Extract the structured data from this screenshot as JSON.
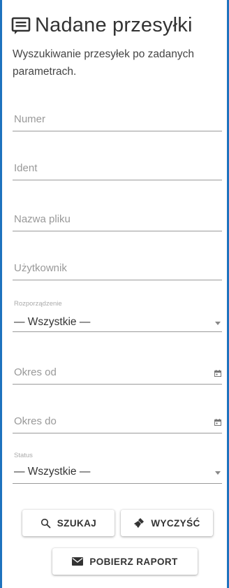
{
  "header": {
    "icon": "message-screen-icon",
    "title": "Nadane przesyłki",
    "subtitle": "Wyszukiwanie przesyłek po zadanych parametrach."
  },
  "form": {
    "numer_placeholder": "Numer",
    "ident_placeholder": "Ident",
    "nazwa_pliku_placeholder": "Nazwa pliku",
    "uzytkownik_placeholder": "Użytkownik",
    "rozporzadzenie_label": "Rozporządzenie",
    "rozporzadzenie_value": "— Wszystkie —",
    "okres_od_placeholder": "Okres od",
    "okres_do_placeholder": "Okres do",
    "status_label": "Status",
    "status_value": "— Wszystkie —"
  },
  "buttons": {
    "szukaj": "SZUKAJ",
    "wyczysc": "WYCZYŚĆ",
    "pobierz_raport": "POBIERZ RAPORT"
  },
  "colors": {
    "frame_border": "#1e73be",
    "text": "#333333",
    "placeholder": "#999999"
  }
}
